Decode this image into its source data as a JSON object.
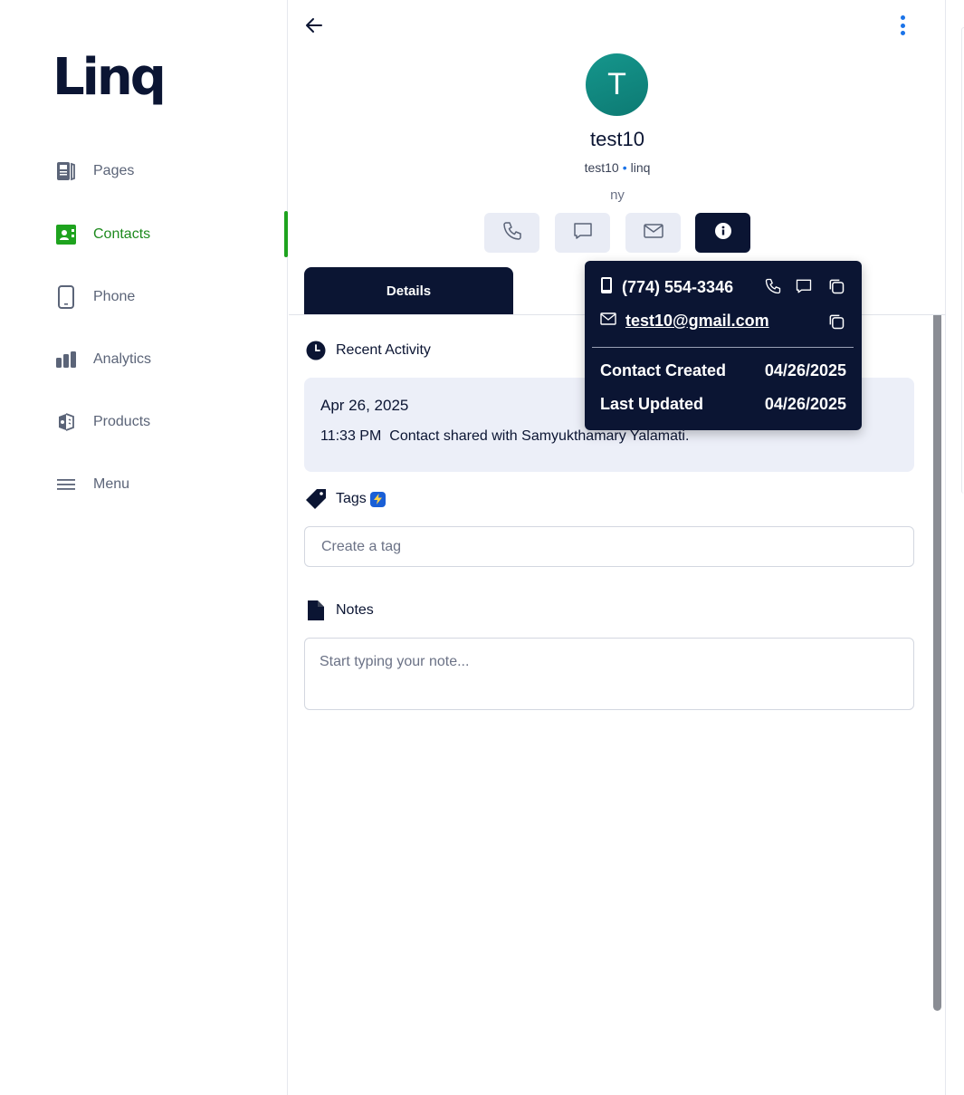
{
  "app": {
    "logo_text": "Linq"
  },
  "sidebar": {
    "items": [
      {
        "label": "Pages",
        "icon": "pages-icon"
      },
      {
        "label": "Contacts",
        "icon": "contacts-icon",
        "active": true
      },
      {
        "label": "Phone",
        "icon": "phone-device-icon"
      },
      {
        "label": "Analytics",
        "icon": "analytics-icon"
      },
      {
        "label": "Products",
        "icon": "products-icon"
      },
      {
        "label": "Menu",
        "icon": "menu-icon"
      }
    ],
    "accent_color": "#1ea31e"
  },
  "contact": {
    "avatar_initial": "T",
    "name": "test10",
    "title": "test10",
    "company": "linq",
    "separator": "•",
    "location": "ny"
  },
  "actions": [
    "phone-icon",
    "message-icon",
    "mail-icon",
    "info-icon"
  ],
  "tabs": [
    {
      "label": "Details",
      "active": true
    }
  ],
  "recent_activity": {
    "heading": "Recent Activity",
    "date": "Apr 26, 2025",
    "time": "11:33 PM",
    "text": "Contact shared with Samyukthamary Yalamati."
  },
  "tags": {
    "heading": "Tags",
    "placeholder": "Create a tag"
  },
  "notes": {
    "heading": "Notes",
    "placeholder": "Start typing your note..."
  },
  "popover": {
    "phone": "(774) 554-3346",
    "email": "test10@gmail.com",
    "created_label": "Contact Created",
    "created_value": "04/26/2025",
    "updated_label": "Last Updated",
    "updated_value": "04/26/2025"
  },
  "colors": {
    "navy": "#0b1533",
    "avatar": "#0d7a73",
    "link_blue": "#1a73e8"
  }
}
